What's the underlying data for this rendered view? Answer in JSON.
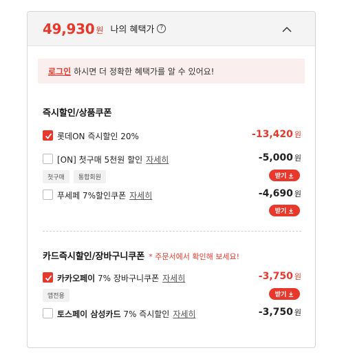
{
  "header": {
    "price": "49,930",
    "price_unit": "원",
    "benefit_title": "나의 혜택가",
    "info_icon": "?"
  },
  "login_notice": {
    "link_text": "로그인",
    "message": "하시면 더 정확한 혜택가를 알 수 있어요!"
  },
  "instant_section": {
    "title": "즉시할인/상품쿠폰",
    "items": [
      {
        "label": "롯데ON 즉시할인 20%",
        "amount": "-13,420",
        "unit": "원",
        "checked": true
      },
      {
        "label": "[ON] 첫구매 5천원 할인",
        "detail": "자세히",
        "amount": "-5,000",
        "unit": "원",
        "checked": false,
        "tags": [
          "첫구매",
          "통합회원"
        ],
        "button": "받기"
      },
      {
        "label": "푸세페 7%할인쿠폰",
        "detail": "자세히",
        "amount": "-4,690",
        "unit": "원",
        "checked": false,
        "button": "받기"
      }
    ]
  },
  "card_section": {
    "title": "카드즉시할인/장바구니쿠폰",
    "note": "* 주문서에서 확인해 보세요!",
    "items": [
      {
        "label_bold": "카카오페이",
        "label": "7% 장바구니쿠폰",
        "detail": "자세히",
        "amount": "-3,750",
        "unit": "원",
        "checked": true,
        "tags": [
          "앱전용"
        ],
        "button": "받기"
      },
      {
        "label_bold": "토스페이 삼성카드",
        "label": "7% 즉시할인",
        "detail": "자세히",
        "amount": "-3,750",
        "unit": "원",
        "checked": false
      }
    ]
  },
  "colors": {
    "accent": "#e8382b",
    "header_bg": "#f4f4f4",
    "notice_bg": "#fbeeee"
  }
}
